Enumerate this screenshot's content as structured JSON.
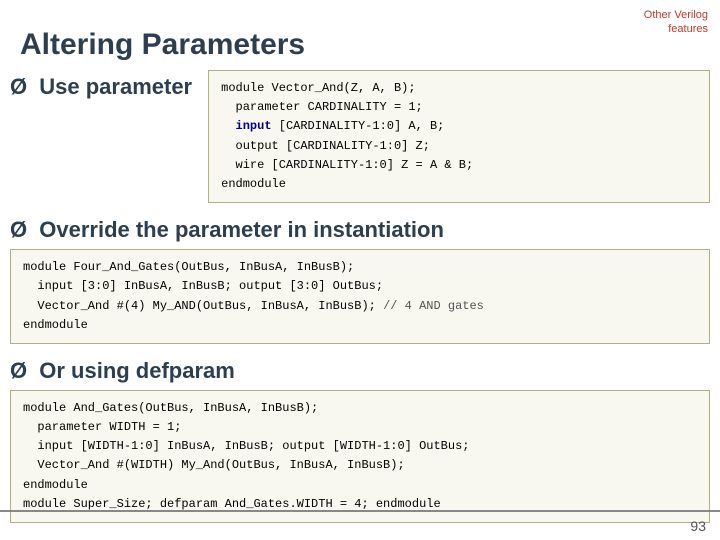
{
  "header": {
    "title": "Altering Parameters",
    "top_right_line1": "Other Verilog",
    "top_right_line2": "features"
  },
  "sections": {
    "use_param": {
      "label": "Use parameter",
      "code_lines": [
        "module Vector_And(Z, A, B);",
        "  parameter CARDINALITY = 1;",
        "  input [CARDINALITY-1:0] A, B;",
        "  output [CARDINALITY-1:0] Z;",
        "  wire [CARDINALITY-1:0] Z = A & B;",
        "endmodule"
      ]
    },
    "override": {
      "heading": "Override the parameter in instantiation",
      "code_lines": [
        "module Four_And_Gates(OutBus, InBusA, InBusB);",
        "  input [3:0] InBusA, InBusB; output [3:0] OutBus;",
        "  Vector_And #(4) My_AND(OutBus, InBusA, InBusB); // 4 AND gates",
        "endmodule"
      ]
    },
    "defparam": {
      "heading": "Or using defparam",
      "code_lines": [
        "module And_Gates(OutBus, InBusA, InBusB);",
        "  parameter WIDTH = 1;",
        "  input [WIDTH-1:0] InBusA, InBusB; output [WIDTH-1:0] OutBus;",
        "  Vector_And #(WIDTH) My_And(OutBus, InBusA, InBusB);",
        "endmodule",
        "module Super_Size; defparam And_Gates.WIDTH = 4; endmodule"
      ]
    }
  },
  "page_number": "93"
}
